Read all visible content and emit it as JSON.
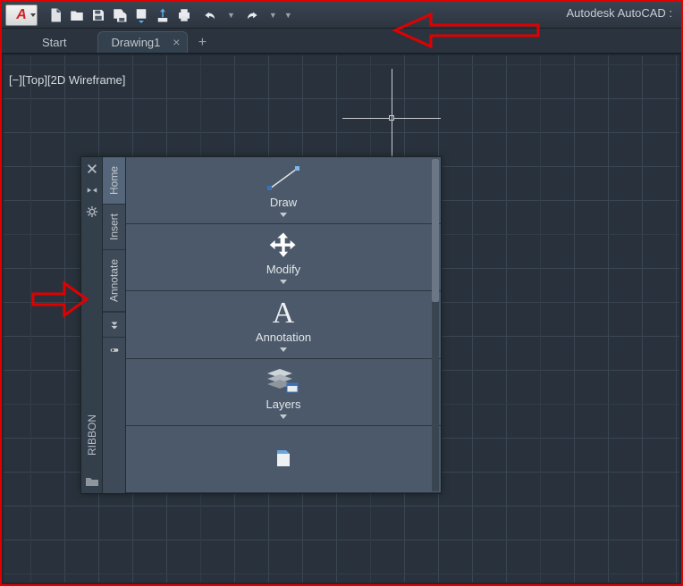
{
  "app_title": "Autodesk AutoCAD :",
  "qat": {
    "buttons": [
      "new",
      "open",
      "save",
      "saveas",
      "cloud",
      "publish",
      "plot",
      "undo",
      "redo"
    ]
  },
  "tabs": {
    "items": [
      {
        "label": "Start",
        "active": false
      },
      {
        "label": "Drawing1",
        "active": true
      }
    ]
  },
  "viewport_label": "[−][Top][2D Wireframe]",
  "palette": {
    "title": "RIBBON",
    "side_icons": [
      "close",
      "dock-toggle",
      "settings"
    ],
    "vtabs": [
      "Home",
      "Insert",
      "Annotate"
    ],
    "panels": [
      {
        "label": "Draw"
      },
      {
        "label": "Modify"
      },
      {
        "label": "Annotation"
      },
      {
        "label": "Layers"
      }
    ]
  }
}
